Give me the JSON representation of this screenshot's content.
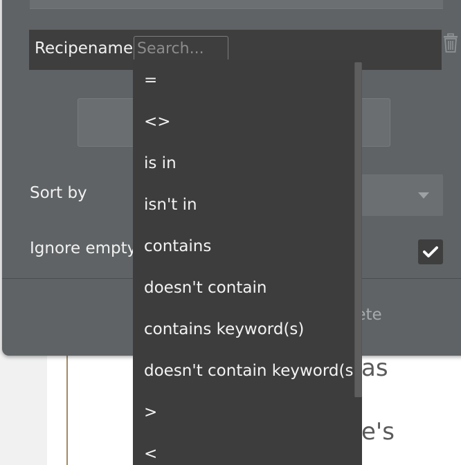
{
  "filter": {
    "field_label": "Recipename",
    "search_placeholder": "Search..."
  },
  "sort": {
    "label": "Sort by"
  },
  "ignore_empty": {
    "label": "Ignore empty",
    "checked": true
  },
  "actions": {
    "delete_label": "lete"
  },
  "background_text": {
    "line1": "as",
    "line2": "e's"
  },
  "operator_dropdown": {
    "options": [
      "=",
      "<>",
      "is in",
      "isn't in",
      "contains",
      "doesn't contain",
      "contains keyword(s)",
      "doesn't contain keyword(s)",
      ">",
      "<"
    ]
  },
  "colors": {
    "panel": "#5f6365",
    "dropdown": "#3d3d3d",
    "link_blue": "#5b8ff0"
  },
  "icons": {
    "trash": "trash-icon",
    "check": "check-icon",
    "chevron": "chevron-down-icon"
  }
}
